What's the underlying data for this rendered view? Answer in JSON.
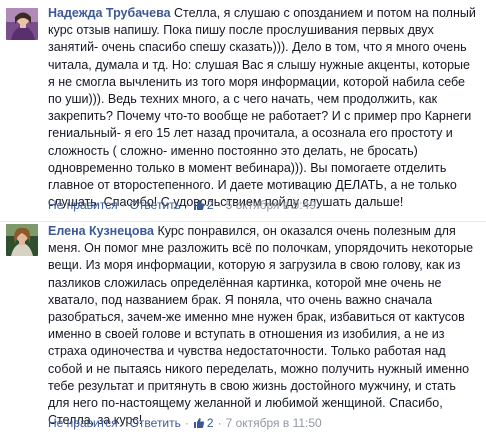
{
  "comments": [
    {
      "author": "Надежда Трубачева",
      "text": "Стелла, я слушаю с опозданием и потом на полный курс отзыв напишу. Пока пишу после прослушивания первых двух занятий- очень спасибо спешу сказать))). Дело в том, что я много очень читала, думала и тд. Но: слушая Вас я слышу нужные акценты, которые я не смогла вычленить из того моря информации, которой набила себе по уши))). Ведь техних много, а с чего начать, чем продолжить, как закрепить? Почему что-то вообще не работает? И с пример про Карнеги гениальный- я его 15 лет назад прочитала, а осознала его простоту и сложность ( сложно- именно постоянно это делать, не бросать) одновременно только в момент вебинара))). Вы помогаете отделить главное от второстепенного. И даете мотивацию ДЕЛАТЬ, а не только слушать. Спасибо! С удовольствием пойду слушать дальше!",
      "unlike_label": "Не нравится",
      "reply_label": "Ответить",
      "likes": "2",
      "timestamp": "5 октября в 9:49",
      "avatar_icon": "user-avatar-photo"
    },
    {
      "author": "Елена Кузнецова",
      "text": "Курс понравился, он оказался очень полезным для меня. Он помог мне разложить всё по полочкам, упорядочить некоторые вещи. Из моря информации, которую я загрузила в свою голову, как из пазликов сложилась определённая картинка, которой мне очень не хватало, под названием брак. Я поняла, что очень важно сначала разобраться, зачем-же именно мне нужен брак, избавиться от кактусов именно в своей голове и вступать в отношения из изобилия, а не из страха одиночества и чувства недостаточности. Только работая над собой и не пытаясь никого переделать, можно получить нужный именно тебе результат и притянуть в свою жизнь достойного мужчину, и стать для него по-настоящему желанной и любимой женщиной. Спасибо, Стелла, за курс!",
      "unlike_label": "Не нравится",
      "reply_label": "Ответить",
      "likes": "2",
      "timestamp": "7 октября в 11:50",
      "avatar_icon": "user-avatar-photo"
    }
  ],
  "separators": {
    "dot": "·"
  },
  "colors": {
    "link": "#3b5998",
    "text": "#141823",
    "meta": "#9197a3",
    "divider": "#e9ebee"
  },
  "icons": {
    "like": "thumbs-up-icon"
  }
}
